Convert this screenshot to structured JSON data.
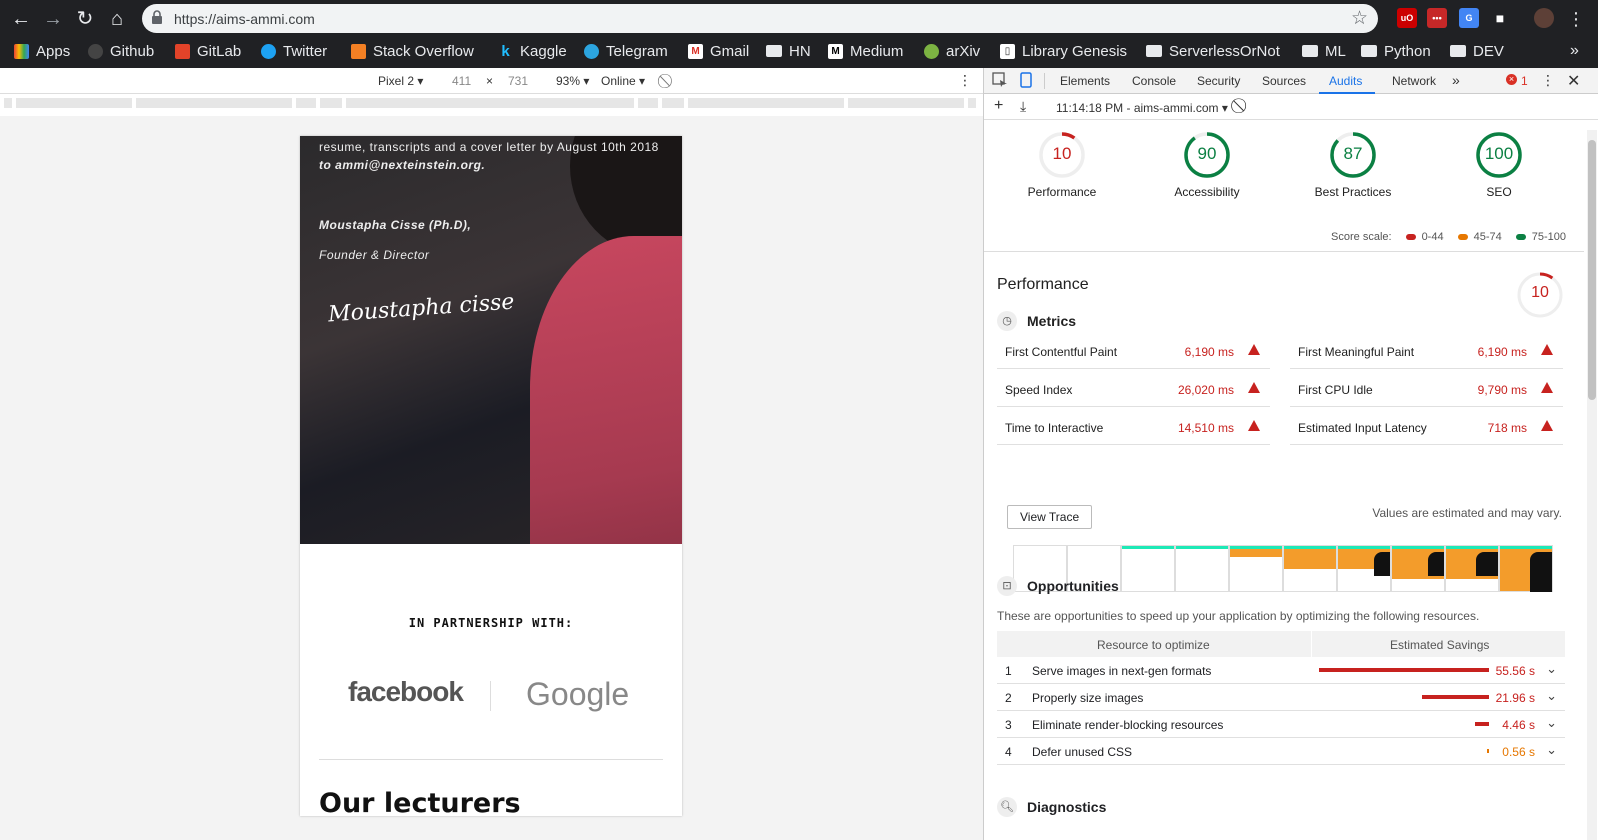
{
  "browser": {
    "url": "https://aims-ammi.com",
    "bookmarks": [
      "Apps",
      "Github",
      "GitLab",
      "Twitter",
      "Stack Overflow",
      "Kaggle",
      "Telegram",
      "Gmail",
      "HN",
      "Medium",
      "arXiv",
      "Library Genesis",
      "ServerlessOrNot",
      "ML",
      "Python",
      "DEV"
    ],
    "more": "»"
  },
  "device_toolbar": {
    "device": "Pixel 2 ▾",
    "width": "411",
    "times": "×",
    "height": "731",
    "zoom": "93% ▾",
    "network": "Online ▾"
  },
  "page": {
    "hero_line1": "resume, transcripts and a cover letter by August 10th 2018",
    "hero_line2": "to ammi@nexteinstein.org.",
    "author": "Moustapha Cisse (Ph.D),",
    "author_role": "Founder & Director",
    "signature": "Moustapha cisse",
    "partnership": "IN PARTNERSHIP WITH:",
    "partner1": "facebook",
    "partner2": "Google",
    "lecturers": "Our lecturers"
  },
  "devtools": {
    "tabs": [
      "Elements",
      "Console",
      "Security",
      "Sources",
      "Audits",
      "Network"
    ],
    "active_tab": "Audits",
    "more_tabs": "»",
    "error_count": "1",
    "report_selector": "11:14:18 PM - aims-ammi.com ▾",
    "colors": {
      "fail": "#c7221f",
      "average": "#e67700",
      "pass": "#0b8043"
    },
    "gauges": [
      {
        "label": "Performance",
        "score": "10",
        "value": 10,
        "status": "fail"
      },
      {
        "label": "Accessibility",
        "score": "90",
        "value": 90,
        "status": "pass"
      },
      {
        "label": "Best Practices",
        "score": "87",
        "value": 87,
        "status": "pass"
      },
      {
        "label": "SEO",
        "score": "100",
        "value": 100,
        "status": "pass"
      }
    ],
    "score_scale": {
      "label": "Score scale:",
      "fail": "0-44",
      "average": "45-74",
      "pass": "75-100"
    },
    "performance_title": "Performance",
    "performance_score": "10",
    "metrics_title": "Metrics",
    "metrics": [
      {
        "name": "First Contentful Paint",
        "value": "6,190 ms"
      },
      {
        "name": "First Meaningful Paint",
        "value": "6,190 ms"
      },
      {
        "name": "Speed Index",
        "value": "26,020 ms"
      },
      {
        "name": "First CPU Idle",
        "value": "9,790 ms"
      },
      {
        "name": "Time to Interactive",
        "value": "14,510 ms"
      },
      {
        "name": "Estimated Input Latency",
        "value": "718 ms"
      }
    ],
    "view_trace": "View Trace",
    "estimate_note": "Values are estimated and may vary.",
    "opportunities_title": "Opportunities",
    "opportunities_desc": "These are opportunities to speed up your application by optimizing the following resources.",
    "opp_headers": [
      "Resource to optimize",
      "Estimated Savings"
    ],
    "opportunities": [
      {
        "n": "1",
        "name": "Serve images in next-gen formats",
        "savings": "55.56 s",
        "seconds": 55.56,
        "status": "fail"
      },
      {
        "n": "2",
        "name": "Properly size images",
        "savings": "21.96 s",
        "seconds": 21.96,
        "status": "fail"
      },
      {
        "n": "3",
        "name": "Eliminate render-blocking resources",
        "savings": "4.46 s",
        "seconds": 4.46,
        "status": "fail"
      },
      {
        "n": "4",
        "name": "Defer unused CSS",
        "savings": "0.56 s",
        "seconds": 0.56,
        "status": "average"
      }
    ],
    "diagnostics_title": "Diagnostics"
  }
}
